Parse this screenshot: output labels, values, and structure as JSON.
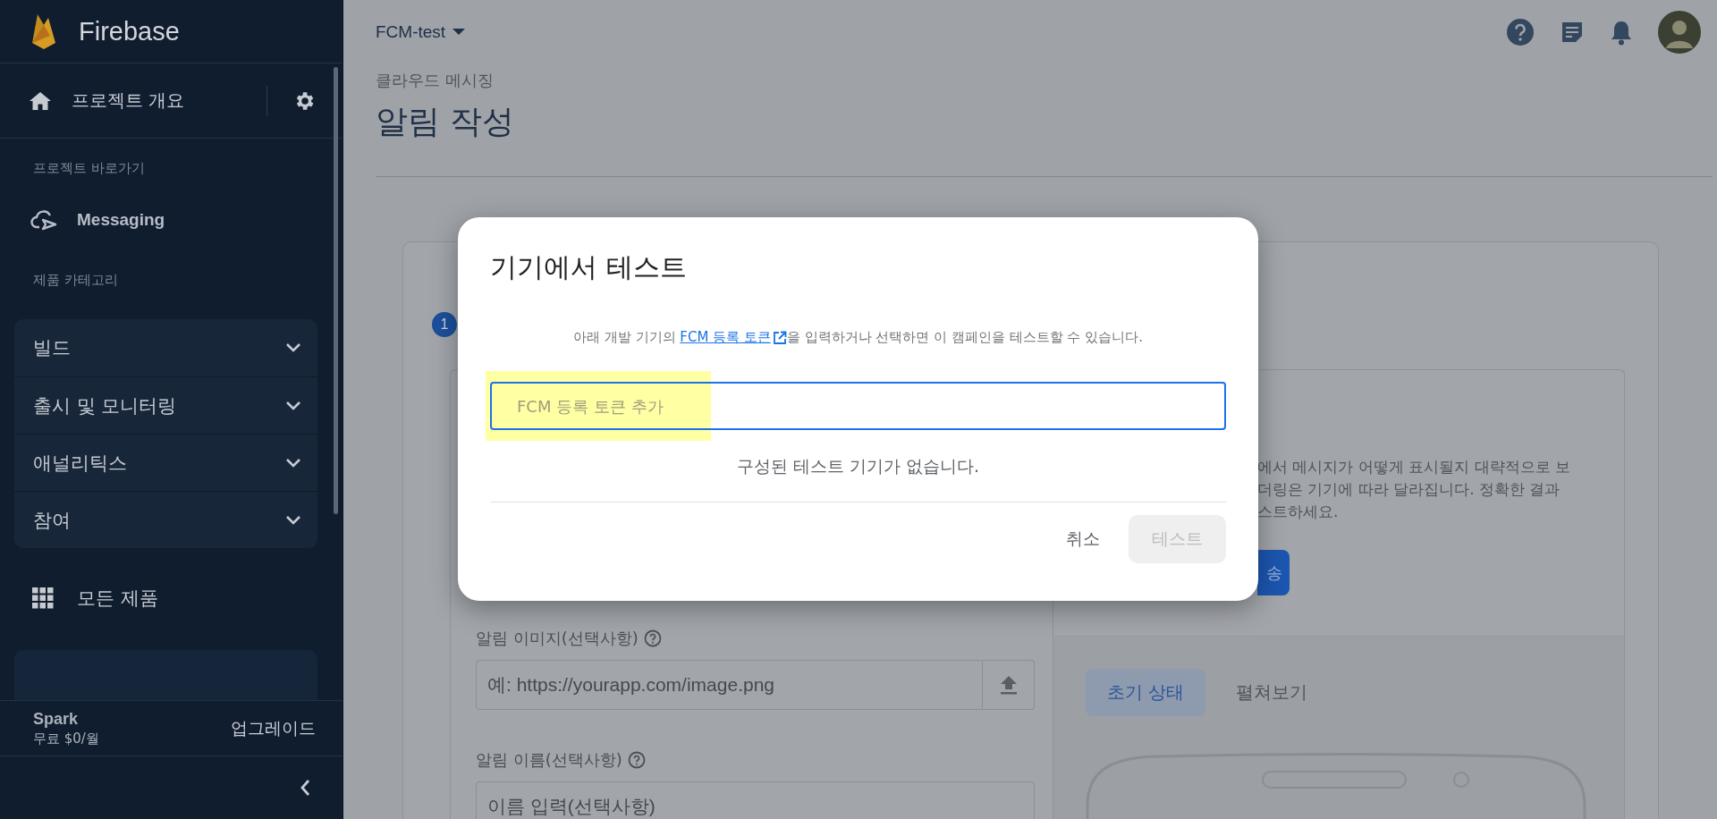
{
  "sidebar": {
    "brand": "Firebase",
    "overview": "프로젝트 개요",
    "shortcuts_label": "프로젝트 바로가기",
    "shortcuts": [
      {
        "label": "Messaging"
      }
    ],
    "categories_label": "제품 카테고리",
    "categories": [
      {
        "label": "빌드",
        "expanded": false
      },
      {
        "label": "출시 및 모니터링",
        "expanded": false
      },
      {
        "label": "애널리틱스",
        "expanded": false
      },
      {
        "label": "참여",
        "expanded": false
      }
    ],
    "all_products": "모든 제품",
    "plan": {
      "name": "Spark",
      "price": "무료 $0/월",
      "upgrade": "업그레이드"
    }
  },
  "header": {
    "project": "FCM-test",
    "breadcrumb": "클라우드 메시징",
    "title": "알림 작성"
  },
  "step": {
    "number": "1"
  },
  "form": {
    "fields": [
      {
        "label": "알림 이미지(선택사항)",
        "placeholder": "예: https://yourapp.com/image.png",
        "kind": "upload"
      },
      {
        "label": "알림 이름(선택사항)",
        "placeholder": "이름 입력(선택사항)",
        "kind": "text"
      }
    ]
  },
  "preview": {
    "description_lines": [
      "에서 메시지가 어떻게 표시될지 대략적으로 보",
      "더링은 기기에 따라 달라집니다. 정확한 결과",
      "스트하세요."
    ],
    "button": "송",
    "tabs": [
      {
        "label": "초기 상태",
        "selected": true
      },
      {
        "label": "펼쳐보기",
        "selected": false
      }
    ]
  },
  "dialog": {
    "title": "기기에서 테스트",
    "description": {
      "before": "아래 개발 기기의 ",
      "link": "FCM 등록 토큰",
      "after": "을 입력하거나 선택하면 이 캠페인을 테스트할 수 있습니다."
    },
    "token_field": {
      "placeholder": "FCM 등록 토큰 추가",
      "highlighted": true
    },
    "empty_message": "구성된 테스트 기기가 없습니다.",
    "buttons": [
      {
        "label": "취소",
        "kind": "text",
        "disabled": false
      },
      {
        "label": "테스트",
        "kind": "filled",
        "disabled": true
      }
    ]
  }
}
